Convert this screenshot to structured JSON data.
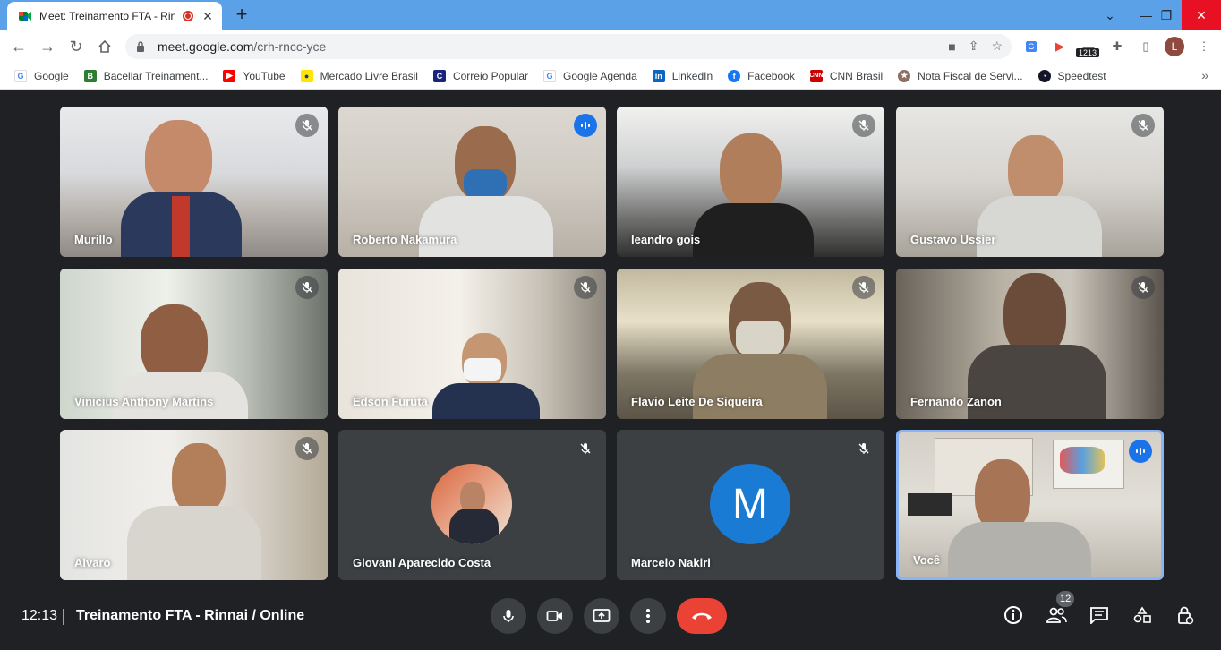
{
  "browser": {
    "tab_title": "Meet: Treinamento FTA - Rin",
    "new_tab_icon": "plus-icon",
    "url_host": "meet.google.com",
    "url_path": "/crh-rncc-yce",
    "extension_badge": "1213",
    "profile_initial": "L",
    "accent": "#5aa1e8"
  },
  "bookmarks": [
    {
      "label": "Google",
      "icon": "google-icon",
      "color": "#4285f4"
    },
    {
      "label": "Bacellar Treinament...",
      "icon": "bacellar-icon",
      "color": "#2e7d32"
    },
    {
      "label": "YouTube",
      "icon": "youtube-icon",
      "color": "#ff0000"
    },
    {
      "label": "Mercado Livre Brasil",
      "icon": "mercado-livre-icon",
      "color": "#ffe600"
    },
    {
      "label": "Correio Popular",
      "icon": "correio-popular-icon",
      "color": "#1a237e"
    },
    {
      "label": "Google Agenda",
      "icon": "google-icon",
      "color": "#4285f4"
    },
    {
      "label": "LinkedIn",
      "icon": "linkedin-icon",
      "color": "#0a66c2"
    },
    {
      "label": "Facebook",
      "icon": "facebook-icon",
      "color": "#1877f2"
    },
    {
      "label": "CNN Brasil",
      "icon": "cnn-icon",
      "color": "#cc0000"
    },
    {
      "label": "Nota Fiscal de Servi...",
      "icon": "nota-fiscal-icon",
      "color": "#8d6e63"
    },
    {
      "label": "Speedtest",
      "icon": "speedtest-icon",
      "color": "#141526"
    }
  ],
  "participants": [
    {
      "name": "Murillo",
      "status": "muted"
    },
    {
      "name": "Roberto Nakamura",
      "status": "speaking"
    },
    {
      "name": "leandro gois",
      "status": "muted"
    },
    {
      "name": "Gustavo Ussier",
      "status": "muted"
    },
    {
      "name": "Vinicius Anthony Martins",
      "status": "muted"
    },
    {
      "name": "Edson Furuta",
      "status": "muted"
    },
    {
      "name": "Flavio Leite De Siqueira",
      "status": "muted"
    },
    {
      "name": "Fernando Zanon",
      "status": "muted"
    },
    {
      "name": "Alvaro",
      "status": "muted"
    },
    {
      "name": "Giovani Aparecido Costa",
      "status": "muted"
    },
    {
      "name": "Marcelo Nakiri",
      "status": "muted",
      "avatar_letter": "M"
    },
    {
      "name": "Você",
      "status": "speaking"
    }
  ],
  "meeting": {
    "time": "12:13",
    "title": "Treinamento FTA - Rinnai / Online",
    "people_count": "12",
    "hangup_color": "#ea4335"
  }
}
